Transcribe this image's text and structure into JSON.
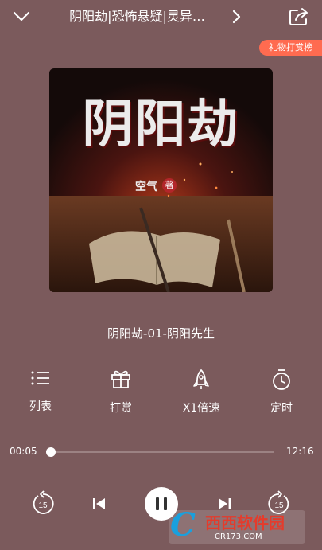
{
  "header": {
    "title": "阴阳劫|恐怖悬疑|灵异…"
  },
  "gift_rank_label": "礼物打赏榜",
  "cover": {
    "title_text": "阴阳劫",
    "author_text": "空气",
    "badge_text": "著"
  },
  "episode_title": "阴阳劫-01-阴阳先生",
  "actions": [
    {
      "label": "列表",
      "icon": "list-icon"
    },
    {
      "label": "打赏",
      "icon": "gift-icon"
    },
    {
      "label": "X1倍速",
      "icon": "rocket-icon"
    },
    {
      "label": "定时",
      "icon": "timer-icon"
    }
  ],
  "progress": {
    "elapsed": "00:05",
    "total": "12:16",
    "fraction": 0.007
  },
  "player": {
    "rewind_seconds": "15",
    "forward_seconds": "15"
  },
  "watermark": {
    "main": "西西软件园",
    "sub": "CR173.COM"
  }
}
